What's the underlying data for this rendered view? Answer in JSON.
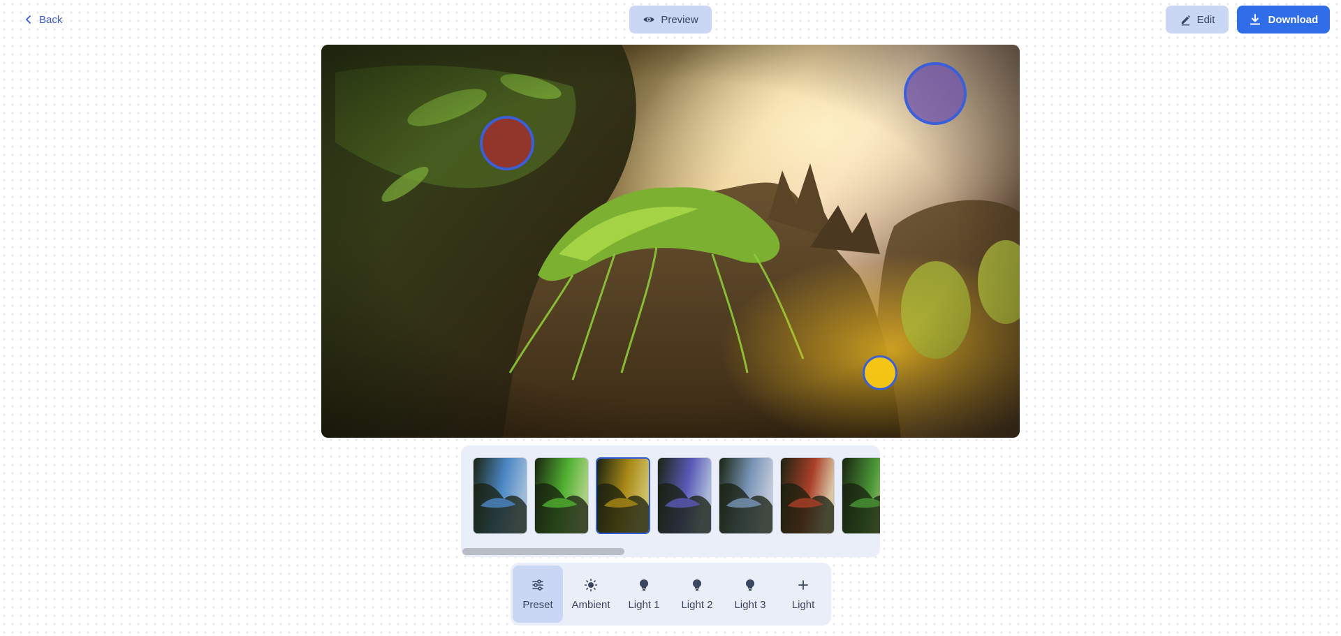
{
  "header": {
    "back_label": "Back",
    "preview_label": "Preview",
    "edit_label": "Edit",
    "download_label": "Download"
  },
  "canvas": {
    "lights": [
      {
        "name": "Light 1",
        "color": "#b02830"
      },
      {
        "name": "Light 2",
        "color": "#7054aa"
      },
      {
        "name": "Light 3",
        "color": "#f8c814"
      }
    ]
  },
  "presets": {
    "selected_index": 2,
    "scroll_fraction": 0.0,
    "items": [
      {
        "tint": "#5aa0e8",
        "glow": "#b8dcff"
      },
      {
        "tint": "#5fd03a",
        "glow": "#c8f59a"
      },
      {
        "tint": "#c8a21c",
        "glow": "#f2e27a"
      },
      {
        "tint": "#6a6ad8",
        "glow": "#c8d8ff"
      },
      {
        "tint": "#8fb0d8",
        "glow": "#e0eaff"
      },
      {
        "tint": "#c84a30",
        "glow": "#ffe8c0"
      },
      {
        "tint": "#58b040",
        "glow": "#d8f0a0"
      }
    ]
  },
  "tools": [
    {
      "label": "Preset",
      "icon": "sliders-icon",
      "active": true
    },
    {
      "label": "Ambient",
      "icon": "sun-icon",
      "active": false
    },
    {
      "label": "Light 1",
      "icon": "bulb-icon",
      "active": false
    },
    {
      "label": "Light 2",
      "icon": "bulb-icon",
      "active": false
    },
    {
      "label": "Light 3",
      "icon": "bulb-icon",
      "active": false
    },
    {
      "label": "Light",
      "icon": "plus-icon",
      "active": false
    }
  ],
  "colors": {
    "accent": "#2f6ee8",
    "handle_border": "#3a5fd8",
    "panel_bg": "#e9eef9",
    "button_soft": "#c9d6f4"
  }
}
